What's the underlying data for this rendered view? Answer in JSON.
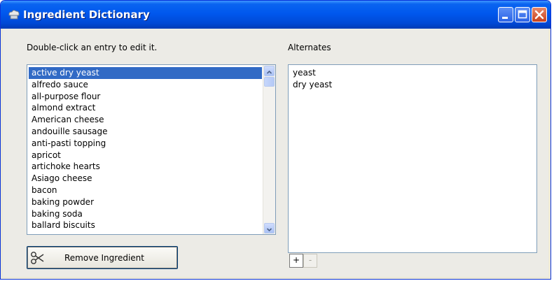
{
  "window": {
    "title": "Ingredient Dictionary",
    "controls": [
      "minimize",
      "maximize",
      "close"
    ]
  },
  "ingredients": {
    "instructions": "Double-click an entry to edit it.",
    "items": [
      "active dry yeast",
      "alfredo sauce",
      "all-purpose flour",
      "almond extract",
      "American cheese",
      "andouille sausage",
      "anti-pasti topping",
      "apricot",
      "artichoke hearts",
      "Asiago cheese",
      "bacon",
      "baking powder",
      "baking soda",
      "ballard biscuits"
    ],
    "selected_index": 0,
    "remove_button_label": "Remove Ingredient"
  },
  "alternates": {
    "label": "Alternates",
    "items": [
      "yeast",
      "dry yeast"
    ],
    "add_label": "+",
    "remove_label": "-"
  },
  "colors": {
    "title_bar": "#0058ee",
    "selection": "#316ac5",
    "client_bg": "#ecebe6",
    "list_border": "#7f9db9"
  }
}
